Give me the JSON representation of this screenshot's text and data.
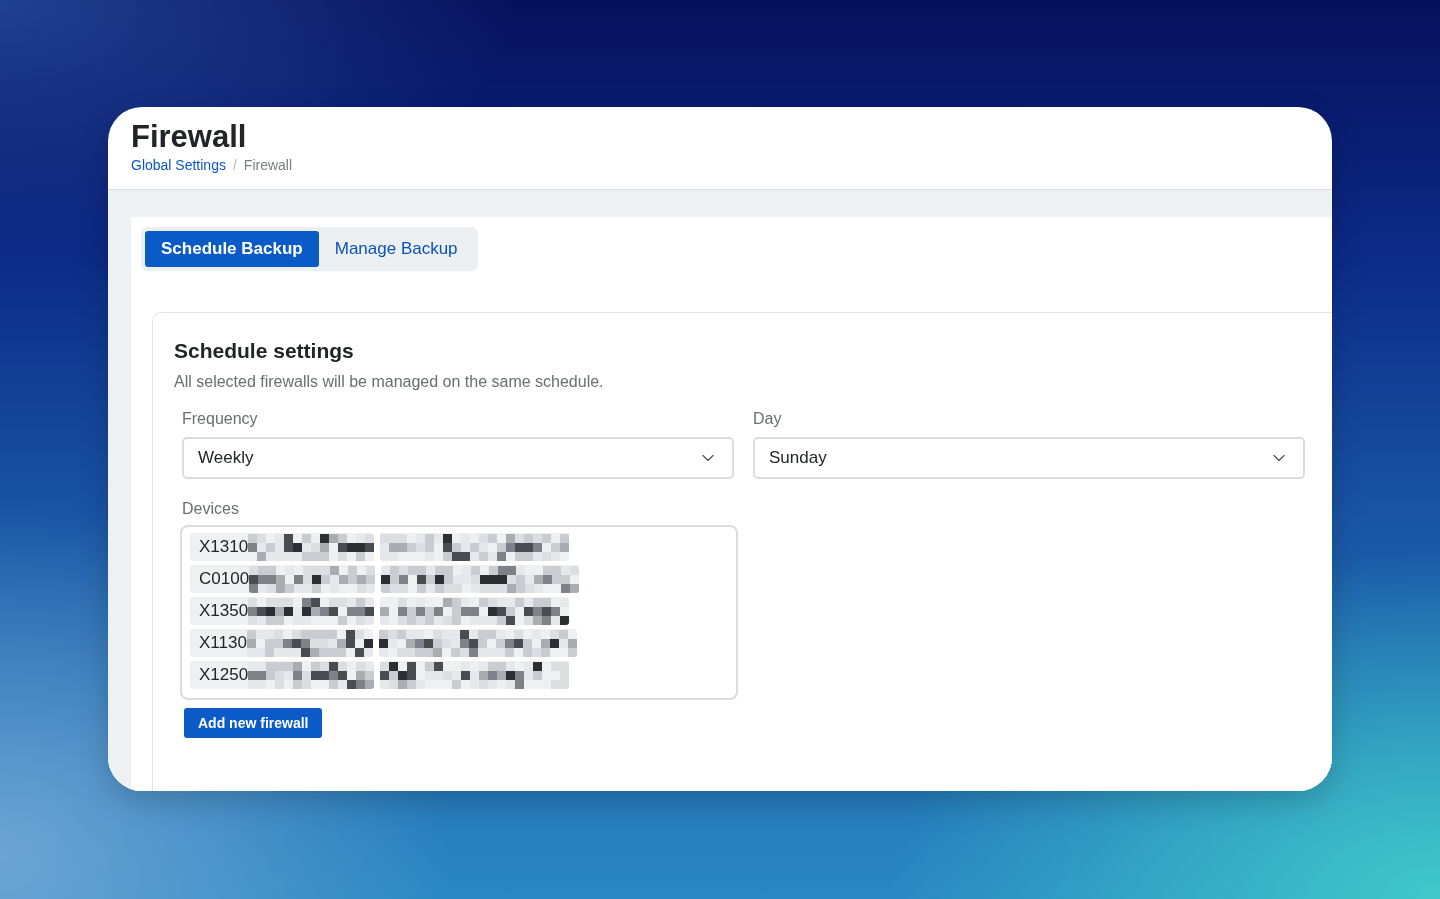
{
  "page": {
    "title": "Firewall",
    "breadcrumb": [
      {
        "label": "Global Settings",
        "kind": "link"
      },
      {
        "label": "Firewall",
        "kind": "current"
      }
    ],
    "separator": "/"
  },
  "tabs": [
    {
      "label": "Schedule Backup",
      "selected": true
    },
    {
      "label": "Manage Backup",
      "selected": false
    }
  ],
  "schedule": {
    "title": "Schedule settings",
    "description": "All selected firewalls will be managed on the same schedule.",
    "fields": [
      {
        "label": "Frequency",
        "value": "Weekly"
      },
      {
        "label": "Day",
        "value": "Sunday"
      }
    ],
    "devices": {
      "label": "Devices",
      "items": [
        {
          "name": "X1310",
          "redacted": true
        },
        {
          "name": "C0100",
          "redacted": true
        },
        {
          "name": "X1350",
          "redacted": true
        },
        {
          "name": "X1130",
          "redacted": true
        },
        {
          "name": "X1250",
          "redacted": true
        }
      ]
    },
    "add_button": "Add new firewall"
  }
}
